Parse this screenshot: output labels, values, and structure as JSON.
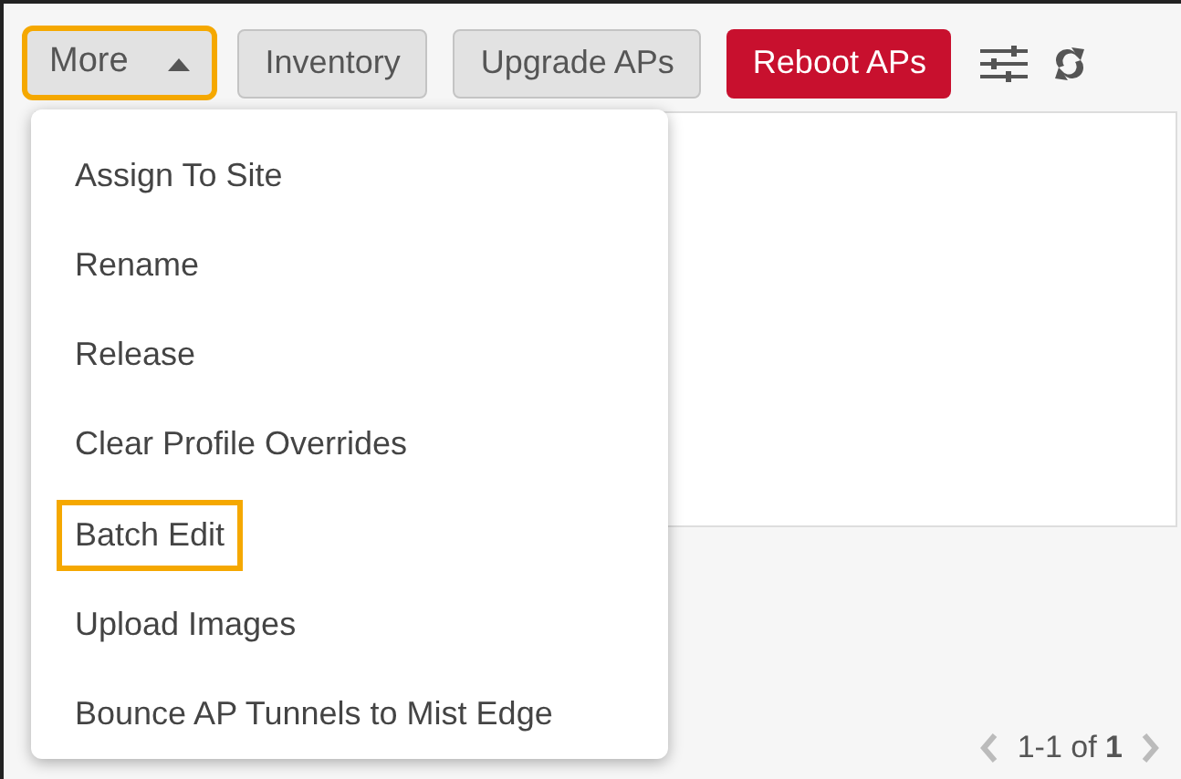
{
  "toolbar": {
    "buttons": [
      {
        "label": "More",
        "kind": "dropdown",
        "expanded": true,
        "highlighted": true
      },
      {
        "label": "Inventory",
        "kind": "default",
        "highlighted": false
      },
      {
        "label": "Upgrade APs",
        "kind": "default",
        "highlighted": false
      },
      {
        "label": "Reboot APs",
        "kind": "danger",
        "highlighted": false
      }
    ]
  },
  "menu": {
    "items": [
      {
        "label": "Assign To Site",
        "highlighted": false
      },
      {
        "label": "Rename",
        "highlighted": false
      },
      {
        "label": "Release",
        "highlighted": false
      },
      {
        "label": "Clear Profile Overrides",
        "highlighted": false
      },
      {
        "label": "Batch Edit",
        "highlighted": true
      },
      {
        "label": "Upload Images",
        "highlighted": false
      },
      {
        "label": "Bounce AP Tunnels to Mist Edge",
        "highlighted": false
      }
    ]
  },
  "pagination": {
    "range": "1-1 of **1**"
  }
}
